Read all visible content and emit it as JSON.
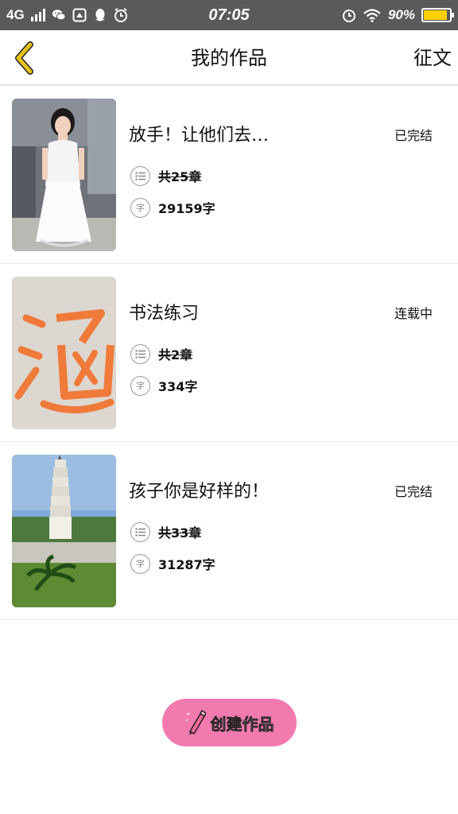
{
  "status_bar": {
    "network": "4G",
    "time": "07:05",
    "battery_percent_text": "90%",
    "battery_level": 0.9,
    "battery_color": "#ffce00",
    "icons": [
      "signal-icon",
      "wechat-icon",
      "gallery-icon",
      "qq-penguin-icon",
      "alarm-icon",
      "alarm-icon",
      "wifi-icon",
      "battery-icon"
    ]
  },
  "nav": {
    "title": "我的作品",
    "action": "征文",
    "back_icon": "chevron-left-icon",
    "back_color": "#e6c21a"
  },
  "works": [
    {
      "title": "放手！让他们去…",
      "status": "已完结",
      "chapters": "共25章",
      "words": "29159字",
      "cover": "girl-in-white-dress-photo"
    },
    {
      "title": "书法练习",
      "status": "连载中",
      "chapters": "共2章",
      "words": "334字",
      "cover": "calligraphy-han-photo"
    },
    {
      "title": "孩子你是好样的！",
      "status": "已完结",
      "chapters": "共33章",
      "words": "31287字",
      "cover": "pagoda-photo"
    }
  ],
  "meta_icons": {
    "chapters_icon": "list-icon",
    "words_icon_char": "字"
  },
  "create_button": {
    "label": "创建作品",
    "icon": "pencil-icon",
    "color": "#f37aaf"
  }
}
